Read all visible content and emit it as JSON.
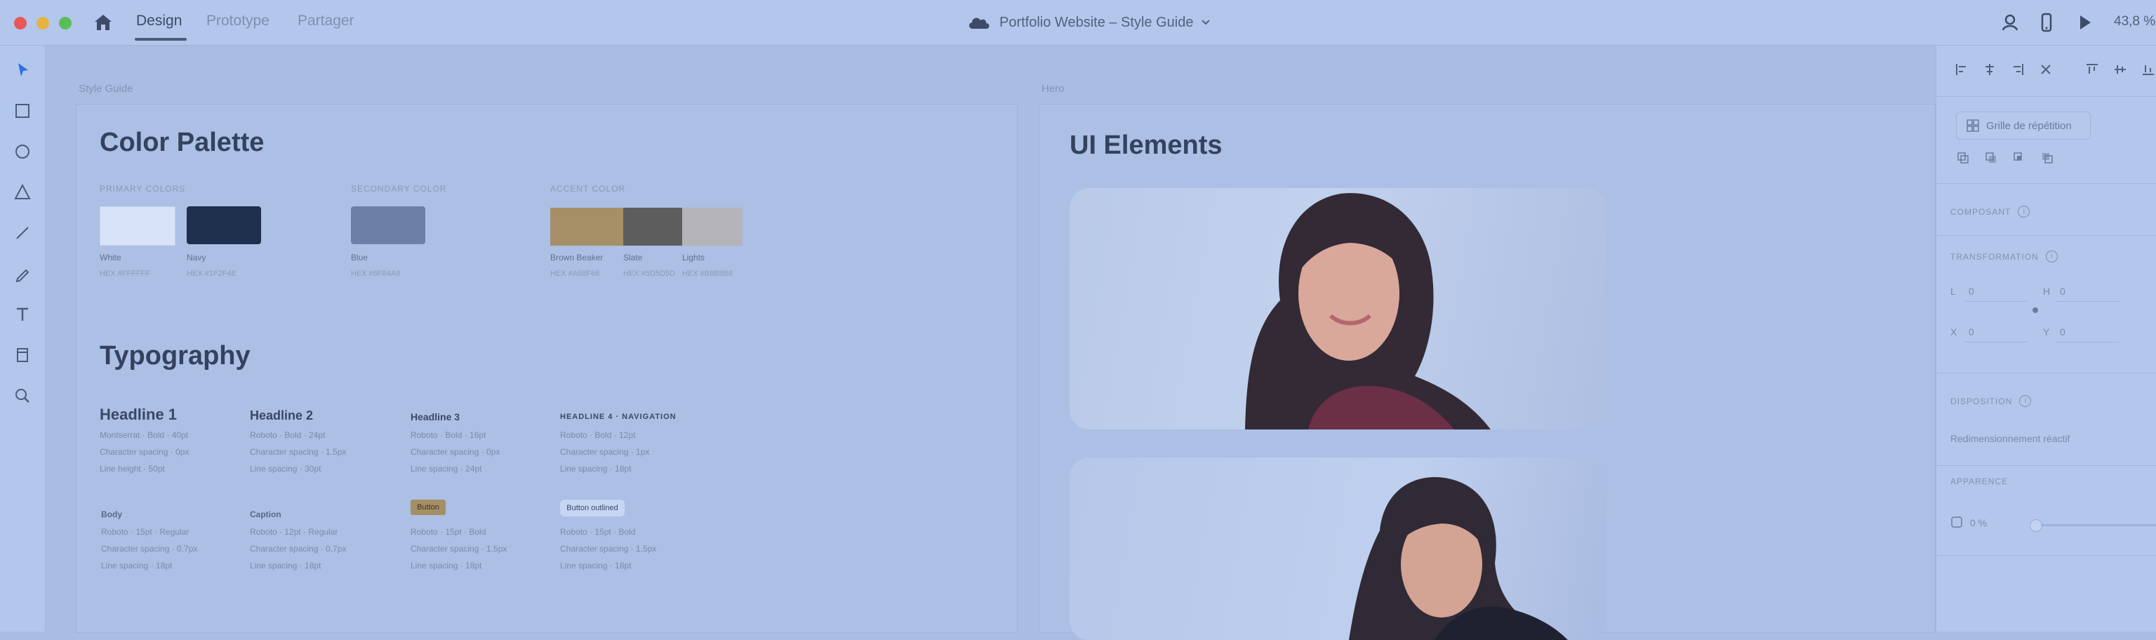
{
  "titlebar": {
    "tabs": [
      "Design",
      "Prototype",
      "Partager"
    ],
    "active_tab": "Design",
    "document_title": "Portfolio Website – Style Guide",
    "zoom": "43,8 %"
  },
  "canvas": {
    "artboards": [
      {
        "label": "Style Guide",
        "color_section": {
          "title": "Color Palette",
          "groups": [
            {
              "label": "Primary colors",
              "swatches": [
                {
                  "name": "White",
                  "hex": "HEX #FFFFFF",
                  "color": "#d8e3f7"
                },
                {
                  "name": "Navy",
                  "hex": "HEX #1F2F4E",
                  "color": "#1f2f4e"
                }
              ]
            },
            {
              "label": "Secondary color",
              "swatches": [
                {
                  "name": "Blue",
                  "hex": "HEX #6F84A9",
                  "color": "#6c80a6"
                }
              ]
            },
            {
              "label": "Accent color",
              "swatches": [
                {
                  "name": "Brown Beaker",
                  "hex": "HEX #A68F66",
                  "color": "#a68f66"
                },
                {
                  "name": "Slate",
                  "hex": "HEX #5D5D5D",
                  "color": "#5d5d5e"
                },
                {
                  "name": "Lights",
                  "hex": "HEX #B8B8B8",
                  "color": "#b4b4b9"
                }
              ]
            }
          ]
        },
        "typography_section": {
          "title": "Typography",
          "styles": [
            {
              "head": "Headline 1",
              "meta": [
                "Montserrat · Bold · 40pt",
                "Character spacing · 0px",
                "Line height · 50pt"
              ]
            },
            {
              "head": "Headline 2",
              "meta": [
                "Roboto · Bold · 24pt",
                "Character spacing · 1.5px",
                "Line spacing · 30pt"
              ]
            },
            {
              "head": "Headline 3",
              "meta": [
                "Roboto · Bold · 16pt",
                "Character spacing · 0px",
                "Line spacing · 24pt"
              ]
            },
            {
              "head": "HEADLINE 4 · NAVIGATION",
              "meta": [
                "Roboto · Bold · 12pt",
                "Character spacing · 1px",
                "Line spacing · 18pt"
              ]
            }
          ],
          "body_styles": [
            {
              "name": "Body",
              "meta": [
                "Roboto · 15pt · Regular",
                "Character spacing · 0.7px",
                "Line spacing · 18pt"
              ]
            },
            {
              "name": "Caption",
              "meta": [
                "Roboto · 12pt · Regular",
                "Character spacing · 0.7px",
                "Line spacing · 18pt"
              ]
            },
            {
              "chip": "Button",
              "meta": [
                "Roboto · 15pt · Bold",
                "Character spacing · 1.5px",
                "Line spacing · 18pt"
              ]
            },
            {
              "chip": "Button outlined",
              "meta": [
                "Roboto · 15pt · Bold",
                "Character spacing · 1.5px",
                "Line spacing · 18pt"
              ]
            }
          ]
        }
      },
      {
        "label": "Hero",
        "ui_section": {
          "title": "UI Elements"
        }
      }
    ]
  },
  "right_panel": {
    "symbol_button": "Grille de répétition",
    "sections": [
      "Composant",
      "Transformation",
      "Disposition",
      "Apparence"
    ],
    "transform": {
      "w_label": "L",
      "w_value": "0",
      "h_label": "H",
      "h_value": "0",
      "x_label": "X",
      "x_value": "0",
      "y_label": "Y",
      "y_value": "0"
    },
    "layout_label": "Redimensionnement réactif",
    "opacity": "0 %"
  }
}
